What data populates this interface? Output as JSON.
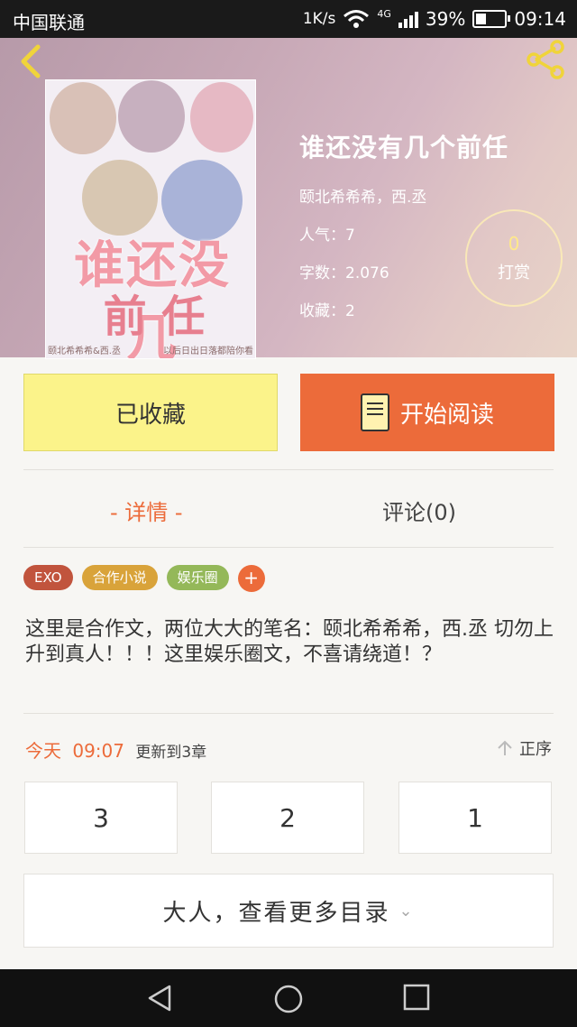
{
  "status_bar": {
    "carrier": "中国联通",
    "speed": "1K/s",
    "network": "4G",
    "battery": "39%",
    "time": "09:14"
  },
  "book": {
    "title": "谁还没有几个前任",
    "authors": "颐北希希希，西.丞",
    "popularity": "人气：7",
    "word_count": "字数：2.076",
    "favorites": "收藏：2",
    "tip_count": "0",
    "tip_label": "打赏",
    "cover_title": "谁还没几",
    "cover_subtitle": "前 任",
    "cover_footer_left": "颐北希希希&西.丞",
    "cover_footer_right": "以后日出日落都陪你看"
  },
  "actions": {
    "favorited_label": "已收藏",
    "read_label": "开始阅读"
  },
  "tabs": {
    "detail": "- 详情 -",
    "comments": "评论(0)"
  },
  "tags": [
    {
      "label": "EXO",
      "color": "#c1543d"
    },
    {
      "label": "合作小说",
      "color": "#d9a33a"
    },
    {
      "label": "娱乐圈",
      "color": "#94b859"
    }
  ],
  "tag_add": "+",
  "description": "这里是合作文，两位大大的笔名：颐北希希希，西.丞 切勿上升到真人！！！这里娱乐圈文，不喜请绕道！？",
  "update": {
    "today": "今天",
    "time": "09:07",
    "text": "更新到3章"
  },
  "order_label": "正序",
  "chapters": [
    "3",
    "2",
    "1"
  ],
  "more_catalog": "大人，查看更多目录"
}
